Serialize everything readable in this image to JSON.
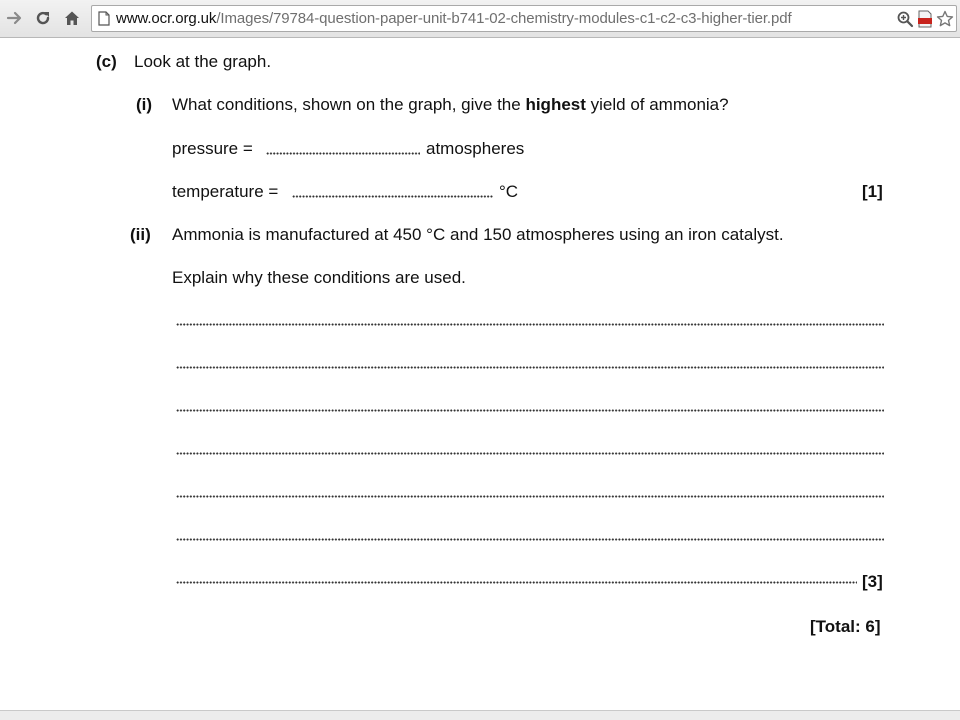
{
  "browser": {
    "url_host": "www.ocr.org.uk",
    "url_path": "/Images/79784-question-paper-unit-b741-02-chemistry-modules-c1-c2-c3-higher-tier.pdf"
  },
  "question": {
    "part_c_label": "(c)",
    "part_c_text": "Look at the graph.",
    "sub_i": {
      "label": "(i)",
      "text_before": "What conditions, shown on the graph, give the ",
      "text_bold": "highest",
      "text_after": " yield of ammonia?",
      "pressure_label": "pressure =",
      "pressure_unit": "atmospheres",
      "temperature_label": "temperature =",
      "temperature_unit": "°C",
      "marks": "[1]"
    },
    "sub_ii": {
      "label": "(ii)",
      "text": "Ammonia is manufactured at 450 °C and 150 atmospheres using an iron catalyst.",
      "instruction": "Explain why these conditions are used.",
      "answer_line_count": 7,
      "marks": "[3]"
    },
    "total": "[Total: 6]"
  }
}
